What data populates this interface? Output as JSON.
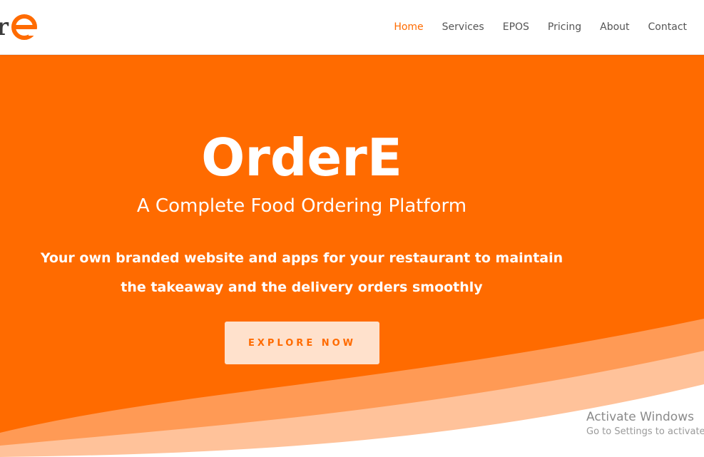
{
  "header": {
    "logo_text": "r",
    "logo_mark_letter": "e",
    "nav": [
      {
        "label": "Home",
        "active": true
      },
      {
        "label": "Services",
        "active": false
      },
      {
        "label": "EPOS",
        "active": false
      },
      {
        "label": "Pricing",
        "active": false
      },
      {
        "label": "About",
        "active": false
      },
      {
        "label": "Contact",
        "active": false
      }
    ]
  },
  "hero": {
    "title": "OrderE",
    "subtitle": "A Complete Food Ordering Platform",
    "description": "Your own branded website and apps for your restaurant to maintain the takeaway and the delivery orders smoothly",
    "button_label": "EXPLORE NOW"
  },
  "watermark": {
    "title": "Activate Windows",
    "subtitle": "Go to Settings to activate Windows."
  },
  "colors": {
    "brand": "#ff6b00",
    "button_bg": "#ffe1cc",
    "nav_text": "#555555"
  }
}
